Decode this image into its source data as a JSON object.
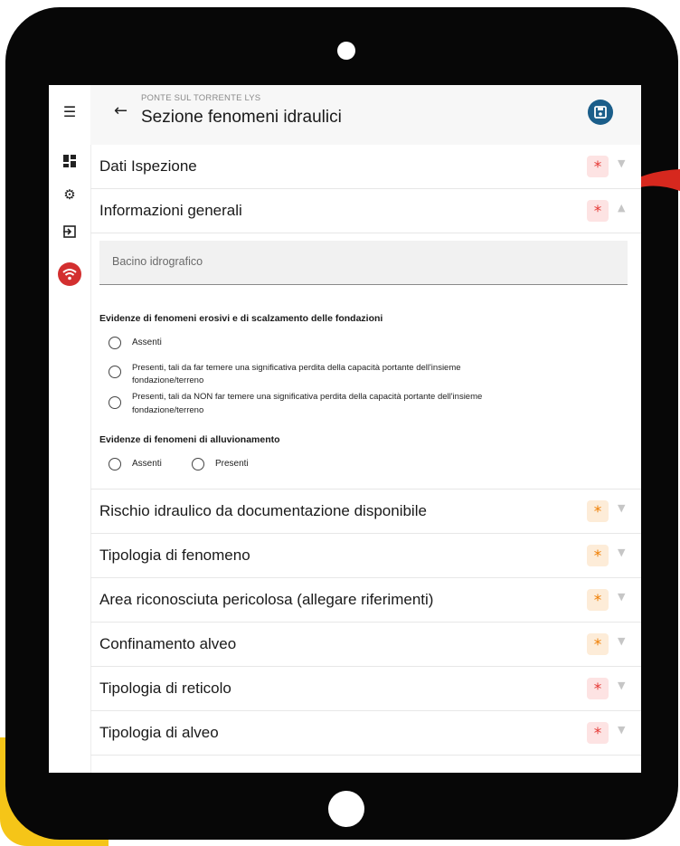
{
  "header": {
    "subtitle": "PONTE SUL TORRENTE LYS",
    "title": "Sezione fenomeni idraulici"
  },
  "sections": [
    {
      "title": "Dati Ispezione",
      "required": "*"
    },
    {
      "title": "Informazioni generali",
      "required": "*"
    },
    {
      "title": "Rischio idraulico da documentazione disponibile",
      "required": "*"
    },
    {
      "title": "Tipologia di fenomeno",
      "required": "*"
    },
    {
      "title": "Area riconosciuta pericolosa (allegare riferimenti)",
      "required": "*"
    },
    {
      "title": "Confinamento alveo",
      "required": "*"
    },
    {
      "title": "Tipologia di reticolo",
      "required": "*"
    },
    {
      "title": "Tipologia di alveo",
      "required": "*"
    }
  ],
  "general_info": {
    "basin_placeholder": "Bacino idrografico",
    "erosion_question": "Evidenze di fenomeni erosivi e di scalzamento delle fondazioni",
    "erosion_options": [
      {
        "line1": "Assenti",
        "line2": ""
      },
      {
        "line1": "Presenti, tali da far temere una significativa perdita della capacità portante dell'insieme",
        "line2": "fondazione/terreno"
      },
      {
        "line1": "Presenti, tali da NON far temere una significativa perdita della capacità portante dell'insieme",
        "line2": "fondazione/terreno"
      }
    ],
    "flood_question": "Evidenze di fenomeni di alluvionamento",
    "flood_options": [
      "Assenti",
      "Presenti"
    ]
  },
  "icons": {
    "menu": "menu-icon",
    "dashboard": "dashboard-icon",
    "settings": "gear-icon",
    "logout": "logout-icon",
    "wifi": "wifi-icon",
    "back": "back-arrow-icon",
    "save": "save-icon"
  },
  "colors": {
    "required_red": "#e53935",
    "required_orange": "#ef7d00",
    "save_button": "#1b5e8a",
    "wifi_button": "#d32f2f"
  }
}
